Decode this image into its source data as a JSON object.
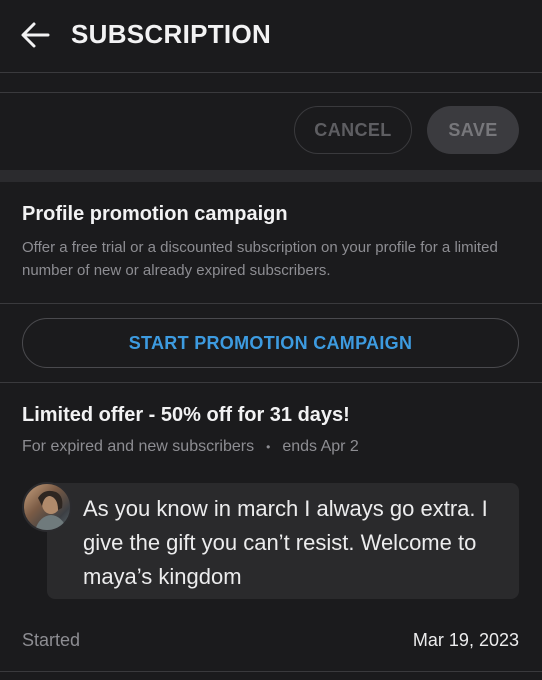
{
  "header": {
    "title": "SUBSCRIPTION",
    "back_icon": "arrow-left-icon"
  },
  "actions": {
    "cancel_label": "CANCEL",
    "save_label": "SAVE"
  },
  "promotion": {
    "title": "Profile promotion campaign",
    "description": "Offer a free trial or a discounted subscription on your profile for a limited number of new or already expired subscribers.",
    "start_label": "START PROMOTION CAMPAIGN"
  },
  "offer": {
    "title": "Limited offer - 50% off for 31 days!",
    "audience": "For expired and new subscribers",
    "separator": "•",
    "ends": "ends Apr 2",
    "message": "As you know in march I always go extra. I give the gift you can’t resist. Welcome to maya’s kingdom",
    "started_label": "Started",
    "started_value": "Mar 19, 2023"
  },
  "colors": {
    "background": "#1b1b1d",
    "accent": "#3d9be0",
    "muted_text": "#8d8d92"
  }
}
